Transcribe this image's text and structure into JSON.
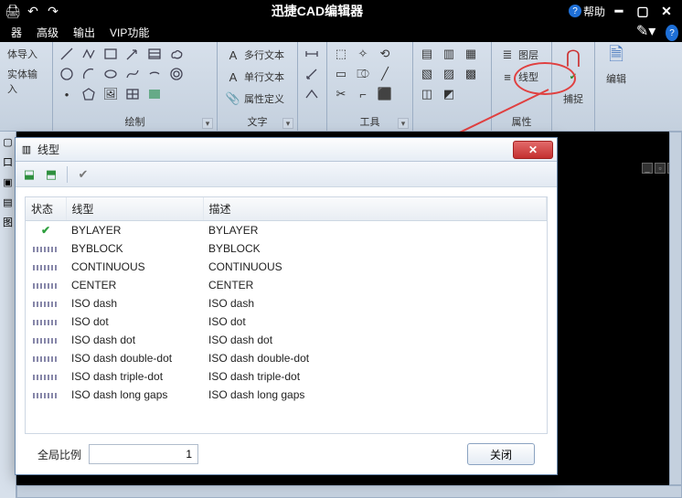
{
  "titlebar": {
    "app_title": "迅捷CAD编辑器",
    "help_label": "帮助"
  },
  "menubar": {
    "items": [
      "器",
      "高级",
      "输出",
      "VIP功能"
    ]
  },
  "ribbon": {
    "group_left": {
      "line1": "体导入",
      "line2": "实体输入"
    },
    "group_draw": {
      "label": "绘制"
    },
    "group_text": {
      "label": "文字",
      "multiline": "多行文本",
      "singleline": "单行文本",
      "attrdef": "属性定义"
    },
    "group_tools": {
      "label": "工具"
    },
    "group_props": {
      "label": "属性",
      "layer": "图层",
      "linetype": "线型"
    },
    "group_snap": {
      "label": "捕捉"
    },
    "group_edit": {
      "label": "编辑"
    }
  },
  "dialog": {
    "title": "线型",
    "columns": {
      "status": "状态",
      "linetype": "线型",
      "description": "描述"
    },
    "rows": [
      {
        "active": true,
        "name": "BYLAYER",
        "desc": "BYLAYER"
      },
      {
        "active": false,
        "name": "BYBLOCK",
        "desc": "BYBLOCK"
      },
      {
        "active": false,
        "name": "CONTINUOUS",
        "desc": "CONTINUOUS"
      },
      {
        "active": false,
        "name": "CENTER",
        "desc": "CENTER"
      },
      {
        "active": false,
        "name": "ISO dash",
        "desc": "ISO dash"
      },
      {
        "active": false,
        "name": "ISO dot",
        "desc": "ISO dot"
      },
      {
        "active": false,
        "name": "ISO dash dot",
        "desc": "ISO dash dot"
      },
      {
        "active": false,
        "name": "ISO dash double-dot",
        "desc": "ISO dash double-dot"
      },
      {
        "active": false,
        "name": "ISO dash triple-dot",
        "desc": "ISO dash triple-dot"
      },
      {
        "active": false,
        "name": "ISO dash long gaps",
        "desc": "ISO dash long gaps"
      }
    ],
    "footer": {
      "scale_label": "全局比例",
      "scale_value": "1",
      "close": "关闭"
    }
  }
}
